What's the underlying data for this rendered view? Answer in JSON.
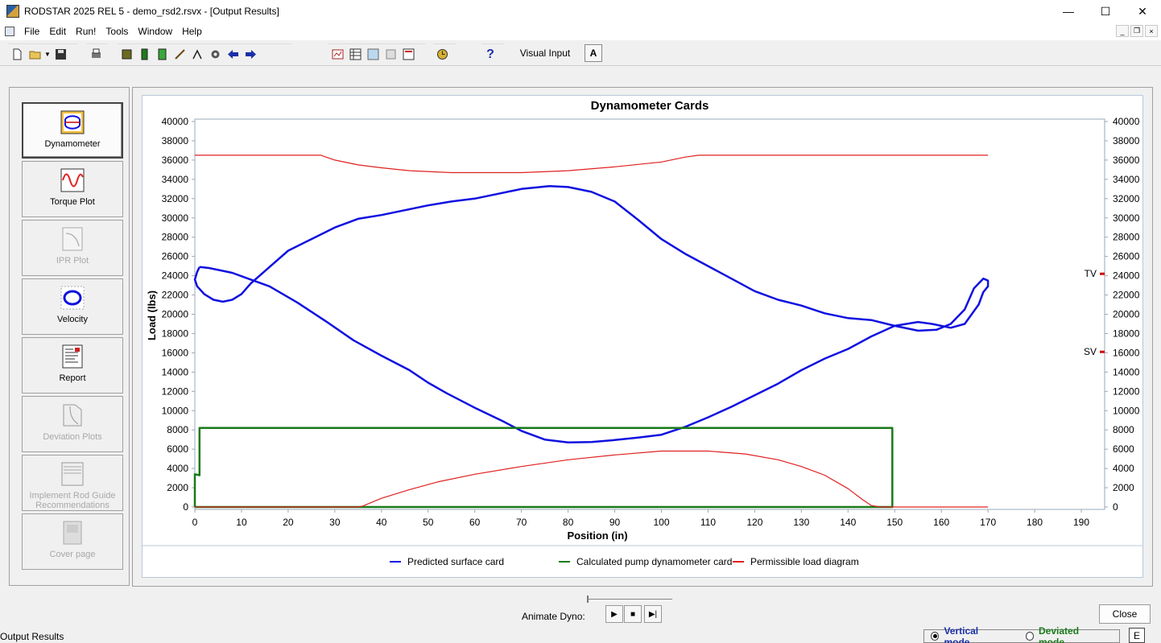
{
  "window": {
    "title": "RODSTAR 2025 REL 5 - demo_rsd2.rsvx - [Output Results]",
    "controls": [
      "—",
      "☐",
      "✕"
    ]
  },
  "menu": {
    "items": [
      "File",
      "Edit",
      "Run!",
      "Tools",
      "Window",
      "Help"
    ],
    "mdi_controls": [
      "_",
      "❐",
      "×"
    ]
  },
  "toolbar": {
    "visual_input_label": "Visual Input",
    "a_label": "A",
    "icons": [
      "new-file-icon",
      "open-folder-icon",
      "save-icon",
      "print-icon",
      "pumping-unit-icon",
      "rod-string-icon",
      "pump-icon",
      "well-icon",
      "motor-icon",
      "gear-icon",
      "back-arrow-icon",
      "forward-arrow-icon",
      "report-icon",
      "table-icon",
      "picture-icon",
      "copy-icon",
      "xbal-icon",
      "clock-icon",
      "help-icon"
    ]
  },
  "nav": {
    "items": [
      {
        "label": "Dynamometer",
        "icon": "dynamometer-icon",
        "state": "active"
      },
      {
        "label": "Torque Plot",
        "icon": "torque-plot-icon",
        "state": "enabled"
      },
      {
        "label": "IPR Plot",
        "icon": "ipr-plot-icon",
        "state": "disabled"
      },
      {
        "label": "Velocity",
        "icon": "velocity-icon",
        "state": "enabled"
      },
      {
        "label": "Report",
        "icon": "report-icon",
        "state": "enabled"
      },
      {
        "label": "Deviation Plots",
        "icon": "deviation-plots-icon",
        "state": "disabled"
      },
      {
        "label": "Implement Rod Guide Recommendations",
        "icon": "rod-guide-icon",
        "state": "disabled"
      },
      {
        "label": "Cover page",
        "icon": "cover-page-icon",
        "state": "disabled"
      }
    ]
  },
  "chart_data": {
    "type": "line",
    "title": "Dynamometer Cards",
    "xlabel": "Position (in)",
    "ylabel": "Load (lbs)",
    "xlim": [
      0,
      195
    ],
    "ylim": [
      0,
      40000
    ],
    "x_ticks": [
      0,
      10,
      20,
      30,
      40,
      50,
      60,
      70,
      80,
      90,
      100,
      110,
      120,
      130,
      140,
      150,
      160,
      170,
      180,
      190
    ],
    "y_ticks": [
      0,
      2000,
      4000,
      6000,
      8000,
      10000,
      12000,
      14000,
      16000,
      18000,
      20000,
      22000,
      24000,
      26000,
      28000,
      30000,
      32000,
      34000,
      36000,
      38000,
      40000
    ],
    "grid": false,
    "legend_position": "bottom",
    "right_axis_markers": [
      {
        "label": "TV",
        "value": 24200,
        "color": "#d00000"
      },
      {
        "label": "SV",
        "value": 16100,
        "color": "#d00000"
      }
    ],
    "series": [
      {
        "name": "Predicted surface card",
        "color": "#1010e0",
        "points": [
          [
            1,
            24900
          ],
          [
            3,
            24800
          ],
          [
            5,
            24600
          ],
          [
            8,
            24300
          ],
          [
            12,
            23600
          ],
          [
            16,
            22900
          ],
          [
            22,
            21200
          ],
          [
            28,
            19300
          ],
          [
            34,
            17300
          ],
          [
            40,
            15700
          ],
          [
            46,
            14200
          ],
          [
            50,
            12900
          ],
          [
            54,
            11800
          ],
          [
            60,
            10300
          ],
          [
            66,
            8900
          ],
          [
            70,
            7900
          ],
          [
            75,
            7000
          ],
          [
            80,
            6700
          ],
          [
            85,
            6750
          ],
          [
            90,
            6950
          ],
          [
            95,
            7200
          ],
          [
            100,
            7500
          ],
          [
            105,
            8300
          ],
          [
            110,
            9300
          ],
          [
            115,
            10400
          ],
          [
            120,
            11600
          ],
          [
            125,
            12800
          ],
          [
            130,
            14200
          ],
          [
            135,
            15400
          ],
          [
            140,
            16400
          ],
          [
            145,
            17700
          ],
          [
            150,
            18800
          ],
          [
            155,
            19200
          ],
          [
            158,
            19000
          ],
          [
            162,
            18600
          ],
          [
            165,
            19000
          ],
          [
            168,
            21000
          ],
          [
            169,
            22300
          ],
          [
            170,
            22900
          ],
          [
            170,
            23500
          ],
          [
            169,
            23700
          ],
          [
            167,
            22700
          ],
          [
            165,
            20500
          ],
          [
            162,
            19000
          ],
          [
            159,
            18400
          ],
          [
            155,
            18300
          ],
          [
            150,
            18800
          ],
          [
            145,
            19400
          ],
          [
            140,
            19600
          ],
          [
            135,
            20100
          ],
          [
            130,
            20900
          ],
          [
            125,
            21500
          ],
          [
            120,
            22400
          ],
          [
            115,
            23700
          ],
          [
            110,
            25000
          ],
          [
            105,
            26300
          ],
          [
            100,
            27800
          ],
          [
            95,
            29800
          ],
          [
            90,
            31700
          ],
          [
            85,
            32700
          ],
          [
            80,
            33200
          ],
          [
            76,
            33300
          ],
          [
            70,
            33000
          ],
          [
            65,
            32500
          ],
          [
            60,
            32000
          ],
          [
            55,
            31700
          ],
          [
            50,
            31300
          ],
          [
            45,
            30800
          ],
          [
            40,
            30300
          ],
          [
            35,
            29900
          ],
          [
            30,
            29000
          ],
          [
            25,
            27800
          ],
          [
            20,
            26600
          ],
          [
            16,
            24900
          ],
          [
            12,
            23200
          ],
          [
            10,
            22100
          ],
          [
            8,
            21500
          ],
          [
            6,
            21300
          ],
          [
            4,
            21500
          ],
          [
            2,
            22100
          ],
          [
            0.5,
            22900
          ],
          [
            0,
            23600
          ],
          [
            0.5,
            24400
          ],
          [
            1,
            24900
          ]
        ]
      },
      {
        "name": "Calculated pump dynamometer card",
        "color": "#1a7a1a",
        "points": [
          [
            0,
            0
          ],
          [
            0,
            3400
          ],
          [
            1,
            3300
          ],
          [
            1,
            8200
          ],
          [
            60,
            8200
          ],
          [
            149,
            8200
          ],
          [
            149.5,
            8200
          ],
          [
            149.5,
            0
          ],
          [
            100,
            0
          ],
          [
            0,
            0
          ]
        ]
      },
      {
        "name": "Permissible load diagram",
        "color": "#e02020",
        "points": [
          [
            0,
            36500
          ],
          [
            27,
            36500
          ],
          [
            30,
            36000
          ],
          [
            35,
            35500
          ],
          [
            40,
            35200
          ],
          [
            46,
            34900
          ],
          [
            55,
            34700
          ],
          [
            70,
            34700
          ],
          [
            80,
            34900
          ],
          [
            90,
            35300
          ],
          [
            100,
            35800
          ],
          [
            105,
            36300
          ],
          [
            108,
            36500
          ],
          [
            170,
            36500
          ]
        ]
      },
      {
        "name": "Permissible load diagram (lower)",
        "color": "#e02020",
        "points": [
          [
            0,
            0
          ],
          [
            35,
            0
          ],
          [
            36,
            100
          ],
          [
            40,
            900
          ],
          [
            46,
            1800
          ],
          [
            52,
            2600
          ],
          [
            60,
            3400
          ],
          [
            70,
            4200
          ],
          [
            80,
            4900
          ],
          [
            90,
            5400
          ],
          [
            100,
            5800
          ],
          [
            110,
            5800
          ],
          [
            118,
            5500
          ],
          [
            125,
            4900
          ],
          [
            130,
            4200
          ],
          [
            135,
            3300
          ],
          [
            140,
            1900
          ],
          [
            143,
            800
          ],
          [
            145,
            150
          ],
          [
            147,
            0
          ],
          [
            170,
            0
          ]
        ]
      }
    ]
  },
  "legend": {
    "items": [
      {
        "label": "Predicted surface card",
        "color": "#1010e0"
      },
      {
        "label": "Calculated pump dynamometer card",
        "color": "#1a7a1a"
      },
      {
        "label": "Permissible load diagram",
        "color": "#e02020"
      }
    ]
  },
  "animate": {
    "label": "Animate Dyno:",
    "buttons": [
      "▶",
      "■",
      "▶|"
    ]
  },
  "close_label": "Close",
  "status": {
    "text": "Output Results",
    "vertical_mode": "Vertical mode",
    "deviated_mode": "Deviated mode",
    "e_label": "E"
  }
}
